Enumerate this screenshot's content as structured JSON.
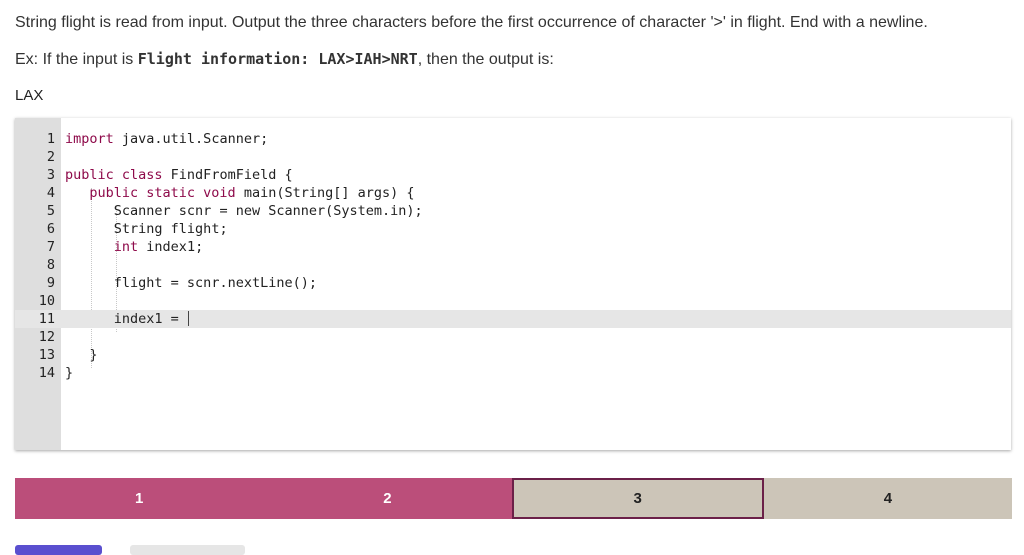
{
  "prompt": "String flight is read from input. Output the three characters before the first occurrence of character '>' in flight. End with a newline.",
  "example": {
    "prefix": "Ex: If the input is ",
    "input": "Flight information: LAX>IAH>NRT",
    "suffix": ", then the output is:",
    "output": "LAX"
  },
  "editor": {
    "active_line": 11,
    "lines": [
      {
        "n": "1",
        "kw": "import",
        "text": " java.util.Scanner;",
        "indent": ""
      },
      {
        "n": "2",
        "kw": "",
        "text": "",
        "indent": ""
      },
      {
        "n": "3",
        "kw": "public class",
        "text": " FindFromField {",
        "indent": ""
      },
      {
        "n": "4",
        "kw": "public static void",
        "text": " main(String[] args) {",
        "indent": "   "
      },
      {
        "n": "5",
        "kw": "",
        "text": "Scanner scnr = new Scanner(System.in);",
        "indent": "      "
      },
      {
        "n": "6",
        "kw": "",
        "text": "String flight;",
        "indent": "      "
      },
      {
        "n": "7",
        "kw": "int",
        "text": " index1;",
        "indent": "      "
      },
      {
        "n": "8",
        "kw": "",
        "text": "",
        "indent": ""
      },
      {
        "n": "9",
        "kw": "",
        "text": "flight = scnr.nextLine();",
        "indent": "      "
      },
      {
        "n": "10",
        "kw": "",
        "text": "",
        "indent": ""
      },
      {
        "n": "11",
        "kw": "",
        "text": "index1 = ",
        "indent": "      "
      },
      {
        "n": "12",
        "kw": "",
        "text": "",
        "indent": ""
      },
      {
        "n": "13",
        "kw": "",
        "text": "}",
        "indent": "   "
      },
      {
        "n": "14",
        "kw": "",
        "text": "}",
        "indent": ""
      }
    ]
  },
  "steps": [
    {
      "label": "1",
      "state": "done"
    },
    {
      "label": "2",
      "state": "done"
    },
    {
      "label": "3",
      "state": "current"
    },
    {
      "label": "4",
      "state": "todo"
    }
  ],
  "colors": {
    "accent": "#bb4e7a",
    "keyword": "#8e0a4a",
    "current_border": "#6b2048"
  }
}
